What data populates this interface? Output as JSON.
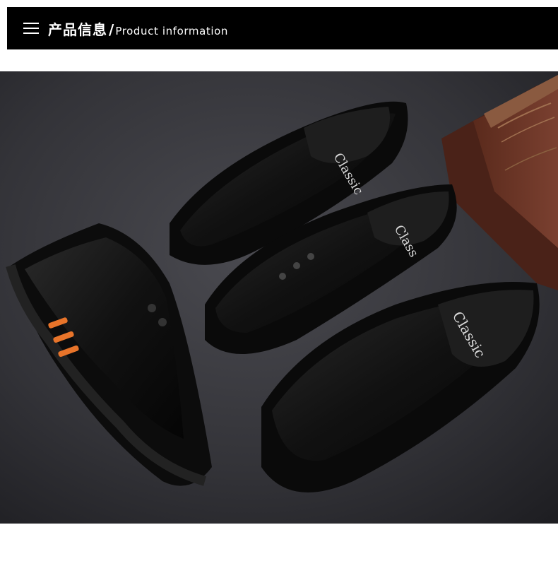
{
  "header": {
    "menu_icon": "hamburger-menu-icon",
    "title_cn": "产品信息",
    "separator": "/",
    "title_en": "Product information"
  },
  "photo": {
    "subject": "black leather men's shoes product photo",
    "insole_brand": "Classic",
    "colors": {
      "background": "#3a3a3e",
      "leather": "#141414",
      "accent_orange": "#e8742a",
      "book": "#6b3524"
    }
  }
}
